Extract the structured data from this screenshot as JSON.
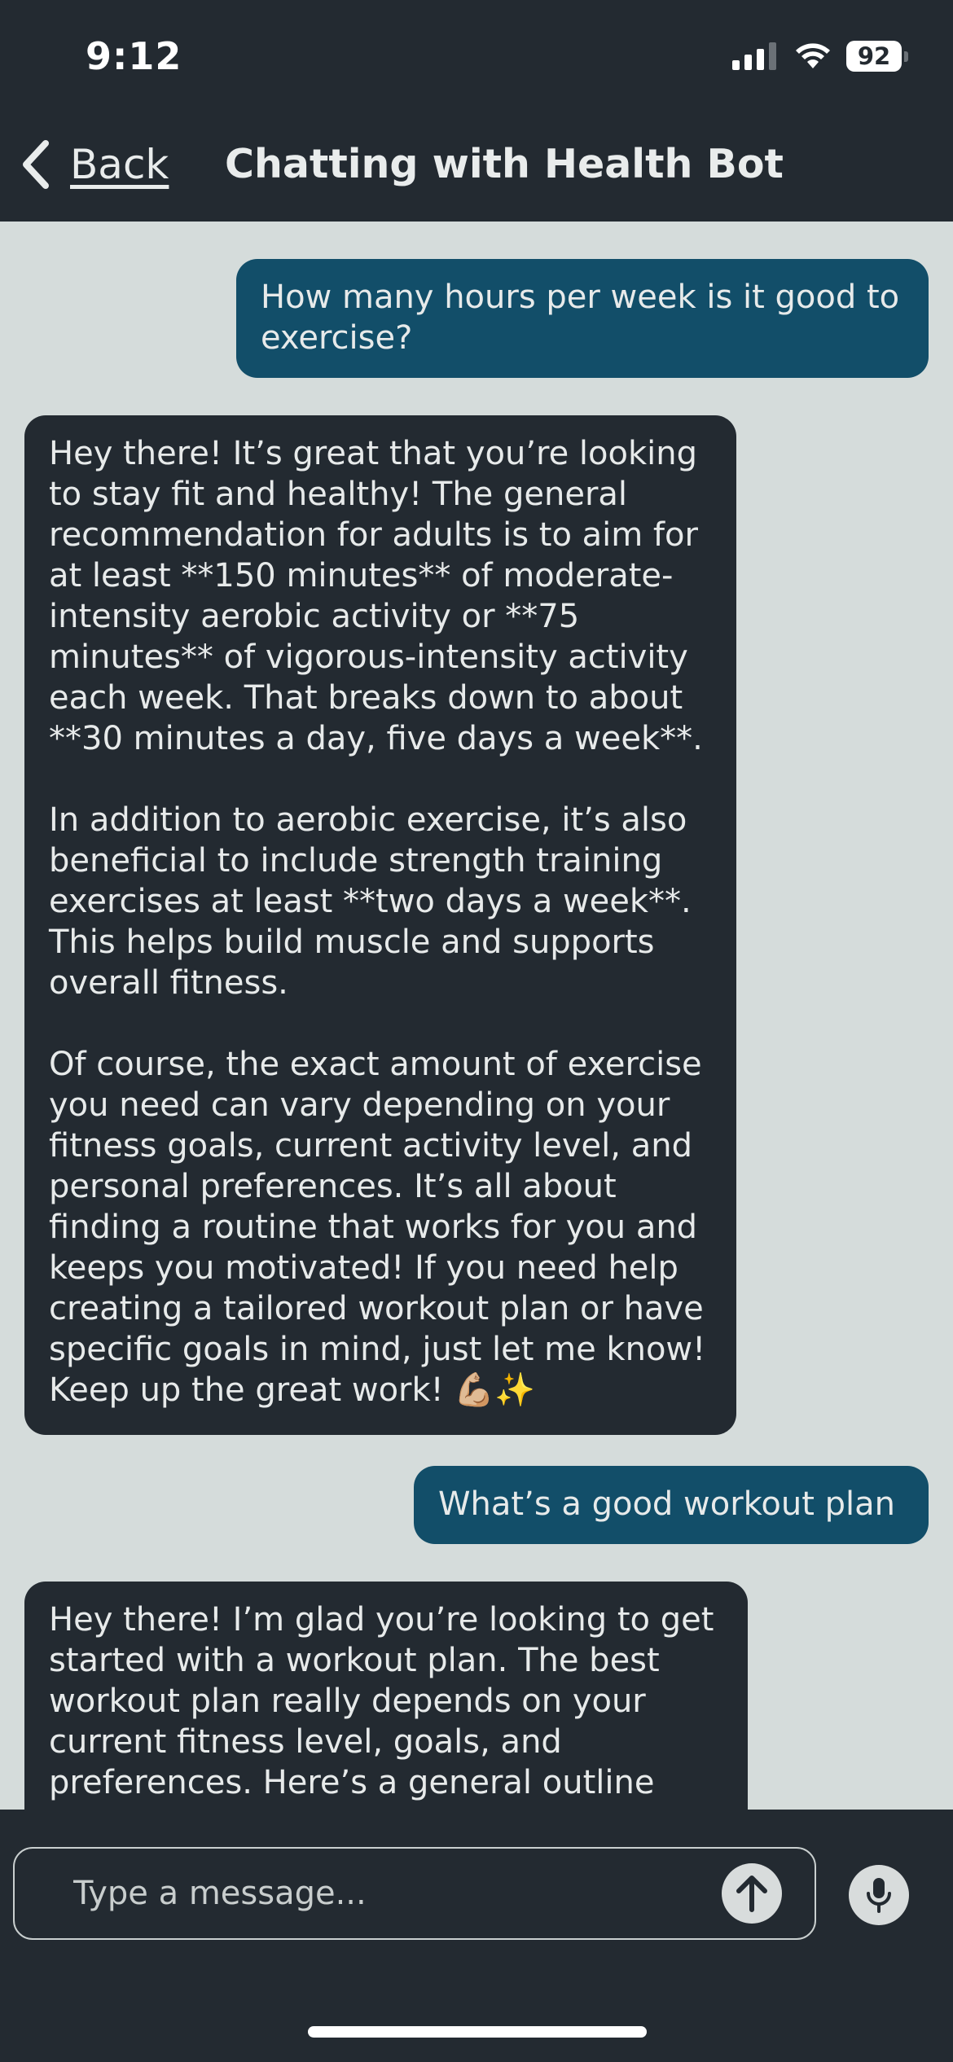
{
  "status_bar": {
    "time": "9:12",
    "battery": "92",
    "signal_icon": "cellular-signal-icon",
    "wifi_icon": "wifi-icon"
  },
  "nav": {
    "back_label": "Back",
    "back_icon": "chevron-left-icon",
    "title": "Chatting with Health Bot"
  },
  "messages": [
    {
      "role": "user",
      "text": "How many hours per week is it good to exercise?"
    },
    {
      "role": "bot",
      "text": "Hey there! It’s great that you’re looking to stay fit and healthy! The general recommendation for adults is to aim for at least **150 minutes** of moderate-intensity aerobic activity or **75 minutes** of vigorous-intensity activity each week. That breaks down to about **30 minutes a day, five days a week**.\n\nIn addition to aerobic exercise, it’s also beneficial to include strength training exercises at least **two days a week**. This helps build muscle and supports overall fitness.\n\nOf course, the exact amount of exercise you need can vary depending on your fitness goals, current activity level, and personal preferences. It’s all about finding a routine that works for you and keeps you motivated! If you need help creating a tailored workout plan or have specific goals in mind, just let me know! Keep up the great work! 💪🏼✨"
    },
    {
      "role": "user",
      "text": "What’s a good workout plan"
    },
    {
      "role": "bot",
      "text": "Hey there! I’m glad you’re looking to get started with a workout plan. The best workout plan really depends on your current fitness level, goals, and preferences. Here’s a general outline"
    }
  ],
  "composer": {
    "placeholder": "Type a message...",
    "send_icon": "arrow-up-icon",
    "mic_icon": "microphone-icon"
  },
  "colors": {
    "header_bg": "#232a31",
    "chat_bg": "#d5dcdb",
    "user_bubble": "#124e69",
    "bot_bubble": "#232a31"
  }
}
